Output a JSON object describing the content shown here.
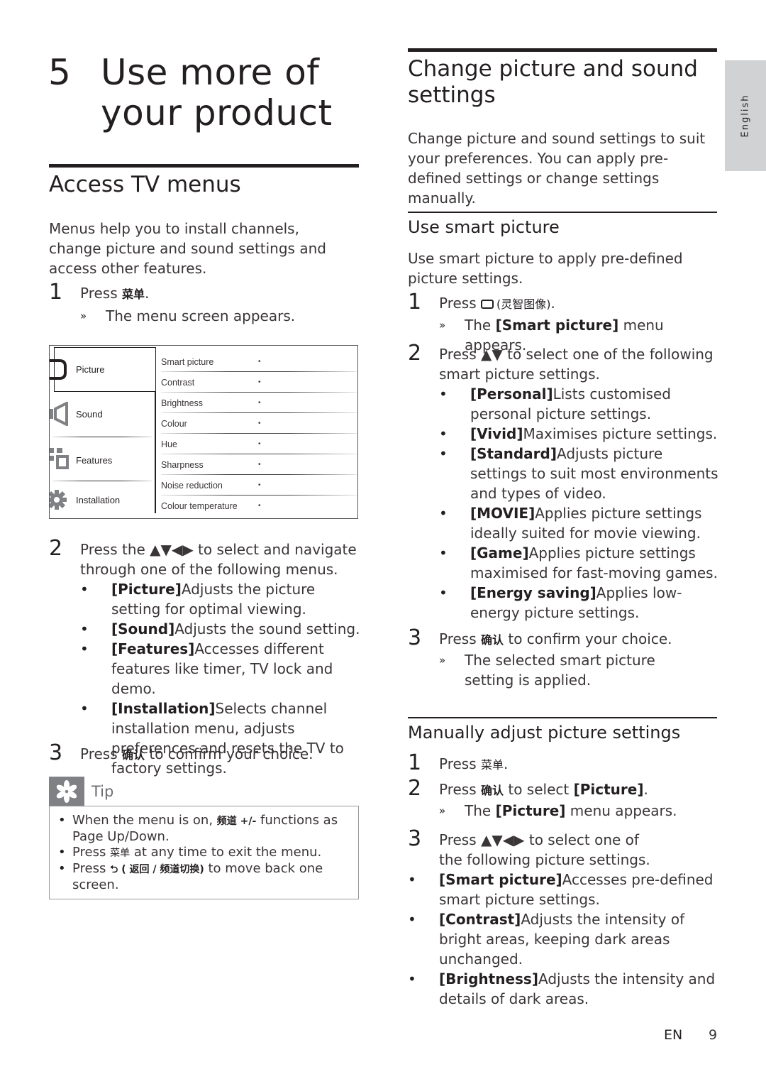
{
  "left": {
    "chapter": {
      "number": "5",
      "title": "Use more of your product"
    },
    "access_menus": {
      "heading": "Access TV menus",
      "intro": "Menus help you to install channels, change picture and sound settings and access other features.",
      "step1": {
        "num": "1",
        "pre": "Press ",
        "key": "菜单",
        "post": ".",
        "result": "The menu screen appears."
      },
      "tv_menu": {
        "categories": [
          {
            "label": "Picture",
            "icon": "picture-icon",
            "selected": true
          },
          {
            "label": "Sound",
            "icon": "speaker-icon",
            "selected": false
          },
          {
            "label": "Features",
            "icon": "features-icon",
            "selected": false
          },
          {
            "label": "Installation",
            "icon": "gear-icon",
            "selected": false
          }
        ],
        "items": [
          {
            "label": "Smart picture",
            "value": "•"
          },
          {
            "label": "Contrast",
            "value": "•"
          },
          {
            "label": "Brightness",
            "value": "•"
          },
          {
            "label": "Colour",
            "value": "•"
          },
          {
            "label": "Hue",
            "value": "•"
          },
          {
            "label": "Sharpness",
            "value": "•"
          },
          {
            "label": "Noise reduction",
            "value": "•"
          },
          {
            "label": "Colour temperature",
            "value": "•"
          }
        ]
      },
      "step2": {
        "num": "2",
        "text": "Press the ▲▼◀▶ to select and navigate through one of the following menus.",
        "bullets": [
          {
            "term": "[Picture]",
            "desc": "Adjusts the picture setting for optimal viewing."
          },
          {
            "term": "[Sound]",
            "desc": "Adjusts the sound setting."
          },
          {
            "term": "[Features]",
            "desc": "Accesses different features like timer, TV lock and demo."
          },
          {
            "term": "[Installation]",
            "desc": "Selects channel installation menu, adjusts preferences and resets the TV to factory settings."
          }
        ]
      },
      "step3": {
        "num": "3",
        "pre": "Press ",
        "key": "确认",
        "post": " to confirm your choice."
      }
    },
    "tip": {
      "label": "Tip",
      "items": [
        {
          "pre": "When the menu is on, ",
          "key": "频道 +/-",
          "post": " functions as Page Up/Down."
        },
        {
          "pre": "Press ",
          "key": "菜单",
          "post": " at any time to exit the menu."
        },
        {
          "pre": "Press ",
          "key": "⮌ ( 返回 / 频道切换)",
          "post": " to move back one screen."
        }
      ]
    }
  },
  "right": {
    "change_settings": {
      "heading": "Change picture and sound settings",
      "intro": "Change picture and sound settings to suit your preferences. You can apply pre-defined settings or change settings manually."
    },
    "smart_picture": {
      "heading": "Use smart picture",
      "intro": "Use smart picture to apply pre-defined picture settings.",
      "step1": {
        "num": "1",
        "pre": "Press ",
        "key": "(灵智图像)",
        "post": ".",
        "result_pre": "The ",
        "result_term": "[Smart picture]",
        "result_post": " menu appears."
      },
      "step2": {
        "num": "2",
        "text": "Press ▲▼ to select one of the following smart picture settings.",
        "bullets": [
          {
            "term": "[Personal]",
            "desc": "Lists customised personal picture settings."
          },
          {
            "term": "[Vivid]",
            "desc": "Maximises picture settings."
          },
          {
            "term": "[Standard]",
            "desc": "Adjusts picture settings to suit most environments and types of video."
          },
          {
            "term": "[MOVIE]",
            "desc": "Applies picture settings ideally suited for movie viewing."
          },
          {
            "term": "[Game]",
            "desc": "Applies picture settings maximised for fast-moving games."
          },
          {
            "term": "[Energy saving]",
            "desc": "Applies low-energy picture settings."
          }
        ]
      },
      "step3": {
        "num": "3",
        "pre": "Press ",
        "key": "确认",
        "post": " to confirm your choice.",
        "result": "The selected smart picture setting is applied."
      }
    },
    "manual": {
      "heading": "Manually adjust picture settings",
      "step1": {
        "num": "1",
        "pre": "Press ",
        "key": "菜单",
        "post": "."
      },
      "step2": {
        "num": "2",
        "pre": "Press ",
        "key": "确认",
        "mid": " to select ",
        "term": "[Picture]",
        "post": ".",
        "result_pre": "The ",
        "result_term": "[Picture]",
        "result_post": " menu appears."
      },
      "step3": {
        "num": "3",
        "text": "Press ▲▼◀▶ to select one of the following picture settings."
      },
      "bullets": [
        {
          "term": "[Smart picture]",
          "desc": "Accesses pre-defined smart picture settings."
        },
        {
          "term": "[Contrast]",
          "desc": "Adjusts the intensity of bright areas, keeping dark areas unchanged."
        },
        {
          "term": "[Brightness]",
          "desc": "Adjusts the intensity and details of dark areas."
        }
      ]
    }
  },
  "side_tab": {
    "label": "English"
  },
  "footer": {
    "lang": "EN",
    "page": "9"
  }
}
